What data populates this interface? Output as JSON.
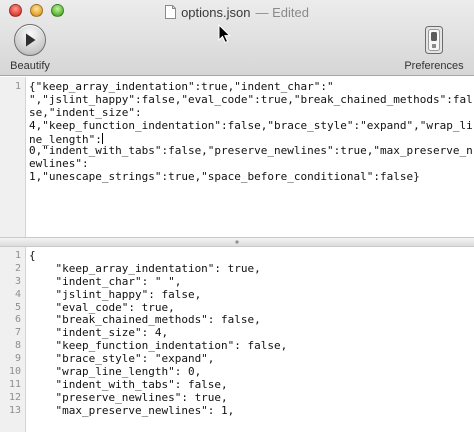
{
  "window": {
    "title": "options.json",
    "status": "— Edited"
  },
  "toolbar": {
    "beautify_label": "Beautify",
    "preferences_label": "Preferences",
    "beautify_icon": "play-icon",
    "preferences_icon": "switch-icon"
  },
  "input_pane": {
    "line_numbers": [
      "1",
      "",
      "",
      "",
      "",
      "",
      "",
      "",
      "",
      ""
    ],
    "lines": [
      "{\"keep_array_indentation\":true,\"indent_char\":\"",
      "\",\"jslint_happy\":false,\"eval_code\":true,\"break_chained_methods\":fal",
      "se,\"indent_size\":",
      "4,\"keep_function_indentation\":false,\"brace_style\":\"expand\",\"wrap_li",
      "ne_length\":",
      "0,\"indent_with_tabs\":false,\"preserve_newlines\":true,\"max_preserve_n",
      "ewlines\":",
      "1,\"unescape_strings\":true,\"space_before_conditional\":false}",
      "",
      ""
    ]
  },
  "output_pane": {
    "line_numbers": [
      "1",
      "2",
      "3",
      "4",
      "5",
      "6",
      "7",
      "8",
      "9",
      "10",
      "11",
      "12",
      "13"
    ],
    "lines": [
      "{",
      "    \"keep_array_indentation\": true,",
      "    \"indent_char\": \" \",",
      "    \"jslint_happy\": false,",
      "    \"eval_code\": true,",
      "    \"break_chained_methods\": false,",
      "    \"indent_size\": 4,",
      "    \"keep_function_indentation\": false,",
      "    \"brace_style\": \"expand\",",
      "    \"wrap_line_length\": 0,",
      "    \"indent_with_tabs\": false,",
      "    \"preserve_newlines\": true,",
      "    \"max_preserve_newlines\": 1,"
    ]
  }
}
